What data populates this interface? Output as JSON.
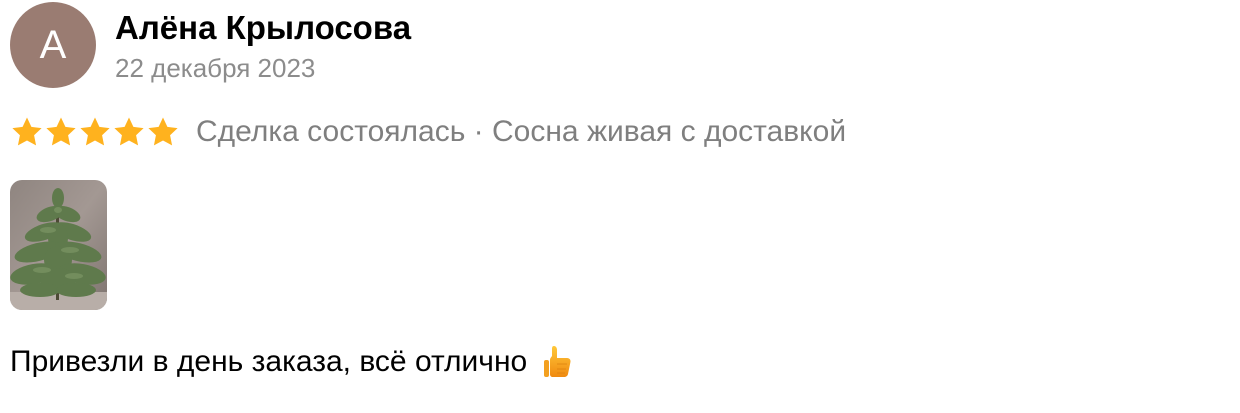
{
  "review": {
    "author": {
      "avatar_letter": "А",
      "name": "Алёна Крылосова"
    },
    "date": "22 декабря 2023",
    "rating": {
      "stars": 5,
      "max": 5,
      "meta": "Сделка состоялась · Сосна живая с доставкой"
    },
    "photos": [
      {
        "icon": "pine-tree-photo"
      }
    ],
    "text": "Привезли в день заказа, всё отлично",
    "emoji": "thumbs-up-icon"
  },
  "colors": {
    "avatar_bg": "#9a7c72",
    "star": "#ffb21e",
    "meta_text": "#7f7f7f",
    "date_text": "#8c8c8c"
  }
}
